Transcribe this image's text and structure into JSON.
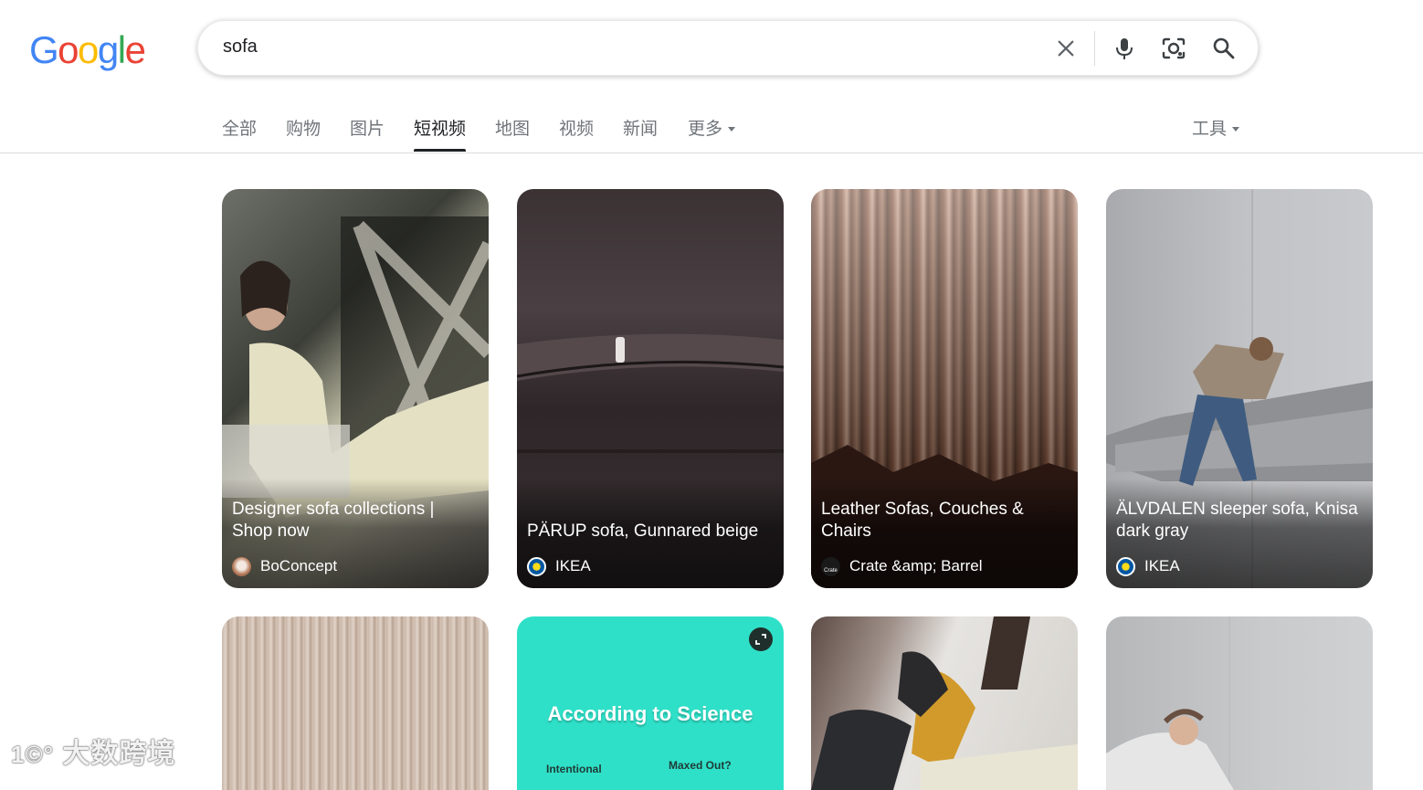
{
  "logo": {
    "letters": [
      "G",
      "o",
      "o",
      "g",
      "l",
      "e"
    ],
    "colors": [
      "#4285F4",
      "#EA4335",
      "#FBBC05",
      "#4285F4",
      "#34A853",
      "#EA4335"
    ]
  },
  "search": {
    "query": "sofa"
  },
  "tabs": [
    {
      "label": "全部"
    },
    {
      "label": "购物"
    },
    {
      "label": "图片"
    },
    {
      "label": "短视频"
    },
    {
      "label": "地图"
    },
    {
      "label": "视频"
    },
    {
      "label": "新闻"
    },
    {
      "label": "更多"
    }
  ],
  "tools_label": "工具",
  "results_row1": [
    {
      "title": "Designer sofa collections | Shop now",
      "source": "BoConcept"
    },
    {
      "title": "PÄRUP sofa, Gunnared beige",
      "source": "IKEA"
    },
    {
      "title": "Leather Sofas, Couches & Chairs",
      "source": "Crate &amp; Barrel"
    },
    {
      "title": "ÄLVDALEN sleeper sofa, Knisa dark gray",
      "source": "IKEA"
    }
  ],
  "results_row2_overlay": {
    "text": "According to Science",
    "sub_left": "Intentional",
    "sub_right": "Maxed Out?"
  },
  "watermark": "大数跨境",
  "colors": {
    "accent": "#202124",
    "muted": "#70757a",
    "teal": "#2fe0c8"
  }
}
